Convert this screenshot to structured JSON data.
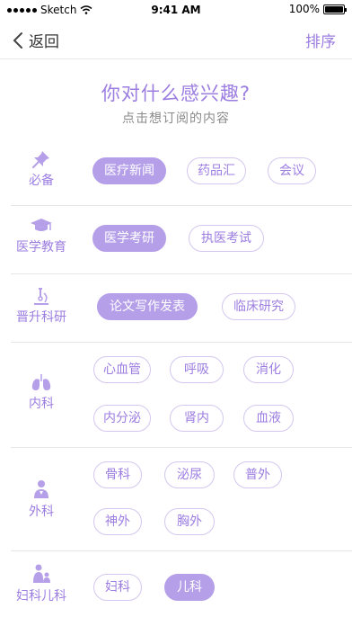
{
  "status_bar": {
    "carrier": "Sketch",
    "time": "9:41 AM",
    "battery": "100%"
  },
  "nav": {
    "back_label": "返回",
    "sort_label": "排序"
  },
  "header": {
    "title": "你对什么感兴趣?",
    "subtitle": "点击想订阅的内容"
  },
  "sections": [
    {
      "label": "必备",
      "icon": "pin-icon",
      "tags": [
        {
          "label": "医疗新闻",
          "selected": true
        },
        {
          "label": "药品汇",
          "selected": false
        },
        {
          "label": "会议",
          "selected": false
        }
      ]
    },
    {
      "label": "医学教育",
      "icon": "graduation-cap-icon",
      "tags": [
        {
          "label": "医学考研",
          "selected": true
        },
        {
          "label": "执医考试",
          "selected": false
        }
      ]
    },
    {
      "label": "晋升科研",
      "icon": "microscope-icon",
      "tags": [
        {
          "label": "论文写作发表",
          "selected": true
        },
        {
          "label": "临床研究",
          "selected": false
        }
      ]
    },
    {
      "label": "内科",
      "icon": "lungs-icon",
      "tags": [
        {
          "label": "心血管",
          "selected": false
        },
        {
          "label": "呼吸",
          "selected": false
        },
        {
          "label": "消化",
          "selected": false
        },
        {
          "label": "内分泌",
          "selected": false
        },
        {
          "label": "肾内",
          "selected": false
        },
        {
          "label": "血液",
          "selected": false
        }
      ]
    },
    {
      "label": "外科",
      "icon": "surgeon-icon",
      "tags": [
        {
          "label": "骨科",
          "selected": false
        },
        {
          "label": "泌尿",
          "selected": false
        },
        {
          "label": "普外",
          "selected": false
        },
        {
          "label": "神外",
          "selected": false
        },
        {
          "label": "胸外",
          "selected": false
        }
      ]
    },
    {
      "label": "妇科儿科",
      "icon": "mother-child-icon",
      "tags": [
        {
          "label": "妇科",
          "selected": false
        },
        {
          "label": "儿科",
          "selected": true
        }
      ]
    }
  ],
  "colors": {
    "accent": "#9c7de0",
    "selected_fill": "#b59fe8",
    "tag_border": "#d3c7ef"
  }
}
